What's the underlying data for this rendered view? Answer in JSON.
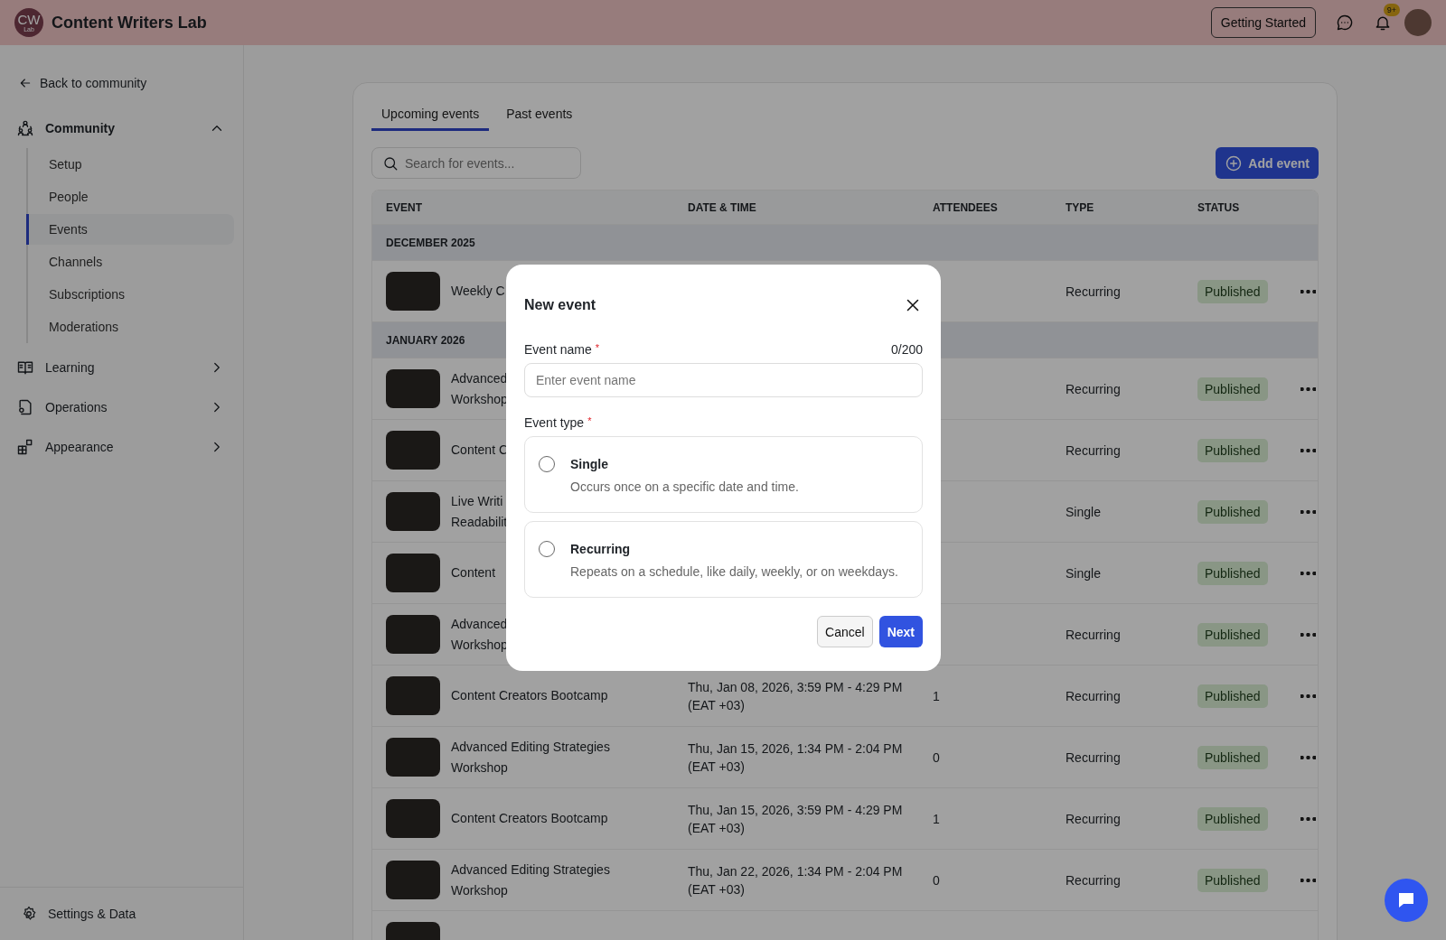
{
  "topbar": {
    "logo": "CW",
    "logo_sub": "Lab",
    "title": "Content Writers Lab",
    "button": "Getting Started",
    "badge": "9+"
  },
  "sidebar": {
    "back": "Back to community",
    "sections": [
      {
        "label": "Community",
        "expanded": true,
        "children": [
          {
            "label": "Setup",
            "selected": false
          },
          {
            "label": "People",
            "selected": false
          },
          {
            "label": "Events",
            "selected": true
          },
          {
            "label": "Channels",
            "selected": false
          },
          {
            "label": "Subscriptions",
            "selected": false
          },
          {
            "label": "Moderations",
            "selected": false
          }
        ]
      },
      {
        "label": "Learning",
        "expanded": false
      },
      {
        "label": "Operations",
        "expanded": false
      },
      {
        "label": "Appearance",
        "expanded": false
      }
    ],
    "footer": "Settings & Data"
  },
  "tabs": [
    {
      "label": "Upcoming events",
      "selected": true
    },
    {
      "label": "Past events",
      "selected": false
    }
  ],
  "search": {
    "placeholder": "Search for events..."
  },
  "add_button": "Add event",
  "table": {
    "columns": [
      "EVENT",
      "DATE & TIME",
      "ATTENDEES",
      "TYPE",
      "STATUS"
    ],
    "groups": [
      {
        "label": "DECEMBER 2025",
        "rows": [
          {
            "name_lines": [
              "Weekly C"
            ],
            "type": "Recurring",
            "status": "Published"
          }
        ]
      },
      {
        "label": "JANUARY 2026",
        "rows": [
          {
            "name_lines": [
              "Advanced",
              "Workshop"
            ],
            "type": "Recurring",
            "status": "Published"
          },
          {
            "name_lines": [
              "Content C"
            ],
            "type": "Recurring",
            "status": "Published"
          },
          {
            "name_lines": [
              "Live Writi",
              "Readabilit"
            ],
            "type": "Single",
            "status": "Published"
          },
          {
            "name_lines": [
              "Content"
            ],
            "type": "Single",
            "status": "Published"
          },
          {
            "name_lines": [
              "Advanced",
              "Workshop"
            ],
            "type": "Recurring",
            "status": "Published"
          },
          {
            "name_lines": [
              "Content Creators Bootcamp"
            ],
            "date": "Thu, Jan 08, 2026, 3:59 PM - 4:29 PM (EAT +03)",
            "attendees": "1",
            "type": "Recurring",
            "status": "Published"
          },
          {
            "name_lines": [
              "Advanced Editing Strategies",
              "Workshop"
            ],
            "date": "Thu, Jan 15, 2026, 1:34 PM - 2:04 PM (EAT +03)",
            "attendees": "0",
            "type": "Recurring",
            "status": "Published"
          },
          {
            "name_lines": [
              "Content Creators Bootcamp"
            ],
            "date": "Thu, Jan 15, 2026, 3:59 PM - 4:29 PM (EAT +03)",
            "attendees": "1",
            "type": "Recurring",
            "status": "Published"
          },
          {
            "name_lines": [
              "Advanced Editing Strategies",
              "Workshop"
            ],
            "date": "Thu, Jan 22, 2026, 1:34 PM - 2:04 PM (EAT +03)",
            "attendees": "0",
            "type": "Recurring",
            "status": "Published"
          },
          {
            "name_lines": []
          }
        ]
      }
    ]
  },
  "modal": {
    "title": "New event",
    "name_field": {
      "label": "Event name",
      "required_mark": "*",
      "counter": "0/200",
      "placeholder": "Enter event name"
    },
    "type_field": {
      "label": "Event type",
      "required_mark": "*"
    },
    "options": [
      {
        "label": "Single",
        "description": "Occurs once on a specific date and time.",
        "selected": false
      },
      {
        "label": "Recurring",
        "description": "Repeats on a schedule, like daily, weekly, or on weekdays.",
        "selected": false
      }
    ],
    "buttons": [
      {
        "label": "Cancel",
        "kind": "secondary"
      },
      {
        "label": "Next",
        "kind": "primary"
      }
    ]
  }
}
